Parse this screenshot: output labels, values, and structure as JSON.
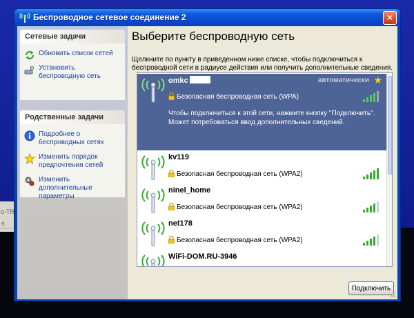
{
  "window": {
    "title": "Беспроводное сетевое соединение 2",
    "close_label": "×"
  },
  "background_window": {
    "text_1": "o-TR",
    "text_2": "s"
  },
  "sidebar": {
    "network_tasks": {
      "title": "Сетевые задачи",
      "items": [
        {
          "label": "Обновить список сетей",
          "icon": "refresh-icon"
        },
        {
          "label": "Установить беспроводную сеть",
          "icon": "setup-wireless-icon"
        }
      ]
    },
    "related_tasks": {
      "title": "Родственные задачи",
      "items": [
        {
          "label": "Подробнее о беспроводных сетях",
          "icon": "info-icon"
        },
        {
          "label": "Изменить порядок предпочтения сетей",
          "icon": "star-icon"
        },
        {
          "label": "Изменить дополнительные параметры",
          "icon": "settings-icon"
        }
      ]
    }
  },
  "main": {
    "title": "Выберите беспроводную сеть",
    "description": "Щелкните по пункту в приведенном ниже списке, чтобы подключиться к беспроводной сети в радиусе действия или получить дополнительные сведения.",
    "connect_button": "Подключить"
  },
  "networks": [
    {
      "ssid": "omkc",
      "security": "Безопасная беспроводная сеть (WPA)",
      "status": "автоматически",
      "signal_bars": 4,
      "selected": true,
      "message": "Чтобы подключиться к этой сети, нажмите кнопку \"Подключить\". Может потребоваться ввод дополнительных сведений."
    },
    {
      "ssid": "kv119",
      "security": "Безопасная беспроводная сеть (WPA2)",
      "signal_bars": 5,
      "selected": false
    },
    {
      "ssid": "ninel_home",
      "security": "Безопасная беспроводная сеть (WPA2)",
      "signal_bars": 4,
      "selected": false
    },
    {
      "ssid": "net178",
      "security": "Безопасная беспроводная сеть (WPA2)",
      "signal_bars": 4,
      "selected": false
    },
    {
      "ssid": "WiFi-DOM.RU-3946",
      "security": "",
      "signal_bars": 0,
      "selected": false
    }
  ],
  "colors": {
    "titlebar": "#0c58e0",
    "selection": "#4f6496",
    "signal": "#3db33d",
    "task_link": "#1f3f9a"
  }
}
